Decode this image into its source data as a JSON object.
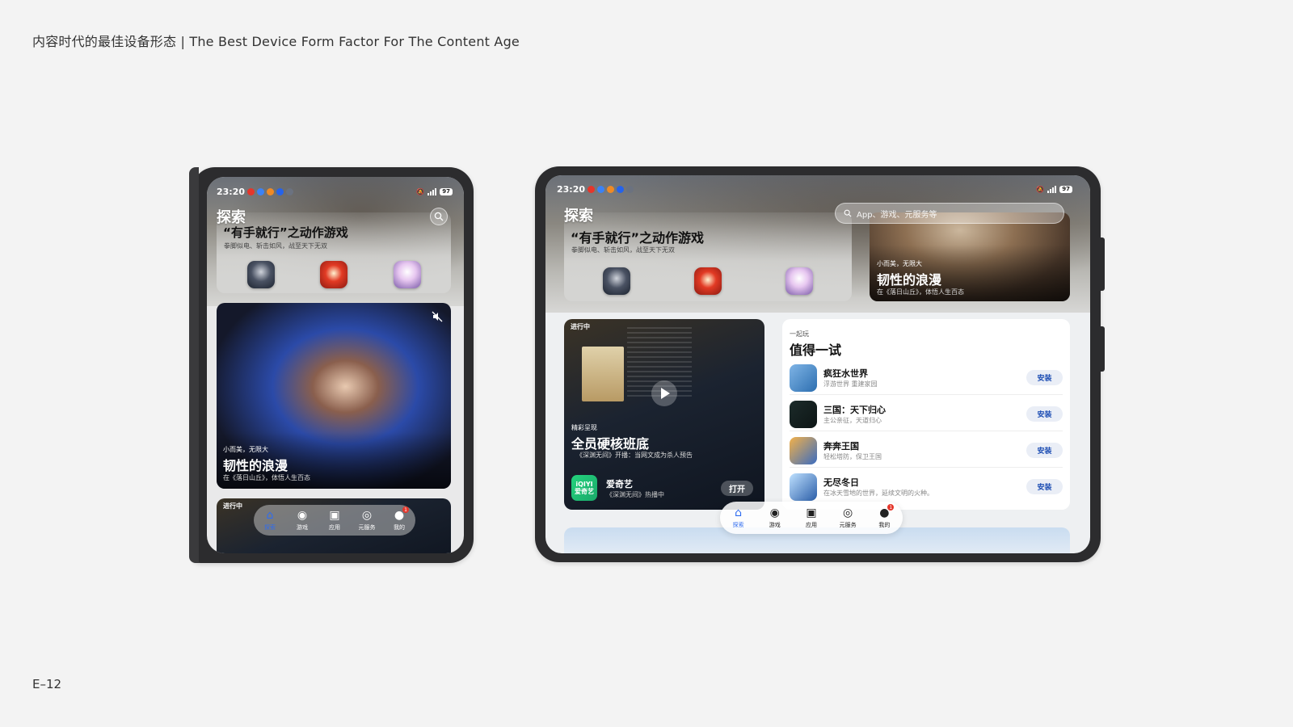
{
  "header": {
    "title": "内容时代的最佳设备形态 | The Best Device Form Factor For The Content Age"
  },
  "footer": {
    "page_number": "E–12"
  },
  "status_bar": {
    "time": "23:20",
    "battery": "97"
  },
  "explore": {
    "title": "探索",
    "feature": {
      "title": "“有手就行”之动作游戏",
      "subtitle": "拳脚似电、斩击如风，战至天下无双"
    },
    "search_placeholder": "App、游戏、元服务等",
    "video_card": {
      "kicker": "小而美，无限大",
      "title": "韧性的浪漫",
      "subtitle": "在《落日山丘》，体悟人生百态"
    },
    "ongoing_card": {
      "badge": "进行中",
      "kicker": "精彩呈现",
      "title": "全员硬核班底",
      "subtitle": "《深渊无间》开播：当网文成为杀人预告",
      "app_name": "爱奇艺",
      "app_desc": "《深渊无间》热播中",
      "app_icon_text": "iQIYI 爱奇艺",
      "open_label": "打开"
    },
    "try_card": {
      "kicker": "一起玩",
      "title": "值得一试",
      "install_label": "安装",
      "items": [
        {
          "name": "疯狂水世界",
          "desc": "浮游世界 重建家园"
        },
        {
          "name": "三国：天下归心",
          "desc": "主公亲征，天道归心"
        },
        {
          "name": "奔奔王国",
          "desc": "轻松塔防，保卫王国"
        },
        {
          "name": "无尽冬日",
          "desc": "在冰天雪地的世界，延续文明的火种。"
        }
      ]
    }
  },
  "nav": {
    "items": [
      {
        "label": "探索",
        "icon": "home-icon"
      },
      {
        "label": "游戏",
        "icon": "gamepad-icon"
      },
      {
        "label": "应用",
        "icon": "apps-icon"
      },
      {
        "label": "元服务",
        "icon": "service-icon"
      },
      {
        "label": "我的",
        "icon": "profile-icon"
      }
    ],
    "badge": "1"
  },
  "colors": {
    "background": "#f3f3f3",
    "device_frame": "#2c2c2e",
    "accent": "#2f6cf0",
    "install_text": "#1f4fb4",
    "badge_red": "#e5362b"
  }
}
